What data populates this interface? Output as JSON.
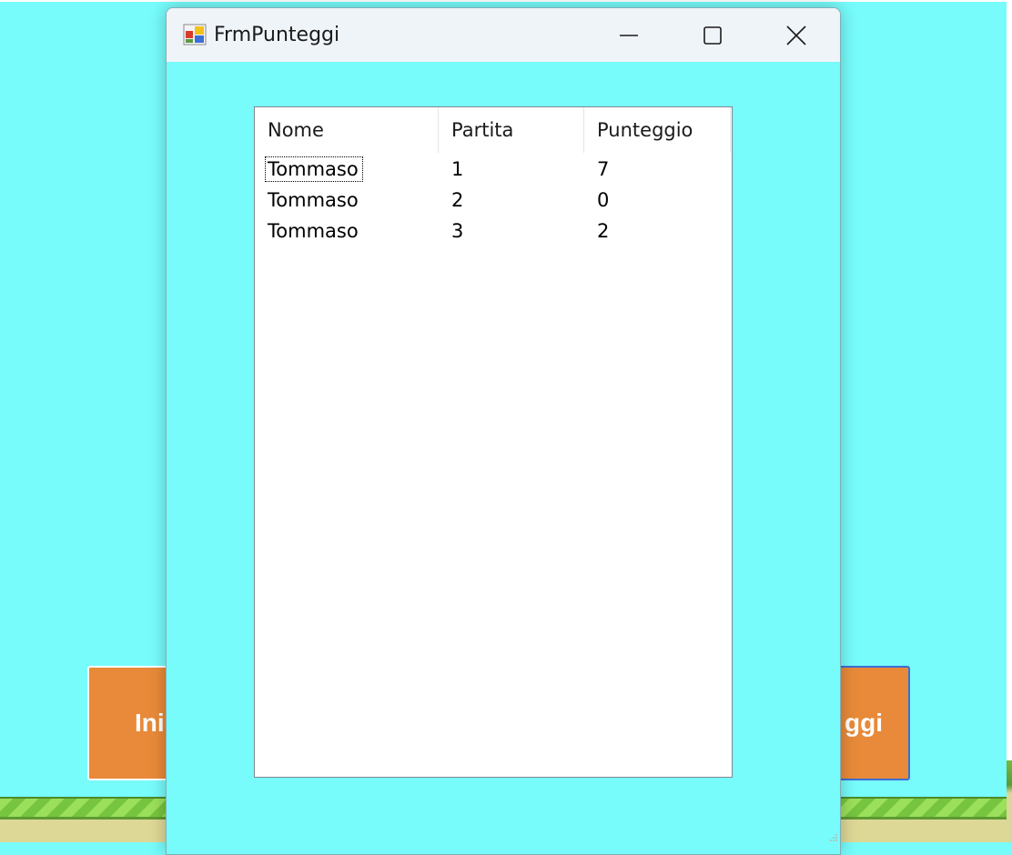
{
  "background_app": {
    "left_button_label": "Ini",
    "right_button_label": "ggi"
  },
  "dialog": {
    "title": "FrmPunteggi",
    "controls": {
      "minimize": "minimize-icon",
      "maximize": "maximize-icon",
      "close": "close-icon"
    },
    "listview": {
      "columns": [
        "Nome",
        "Partita",
        "Punteggio"
      ],
      "rows": [
        [
          "Tommaso",
          "1",
          "7"
        ],
        [
          "Tommaso",
          "2",
          "0"
        ],
        [
          "Tommaso",
          "3",
          "2"
        ]
      ],
      "focused_row": 0
    }
  },
  "colors": {
    "sky": "#77fbfb",
    "button_orange": "#e88a39",
    "titlebar": "#eff4f9"
  }
}
